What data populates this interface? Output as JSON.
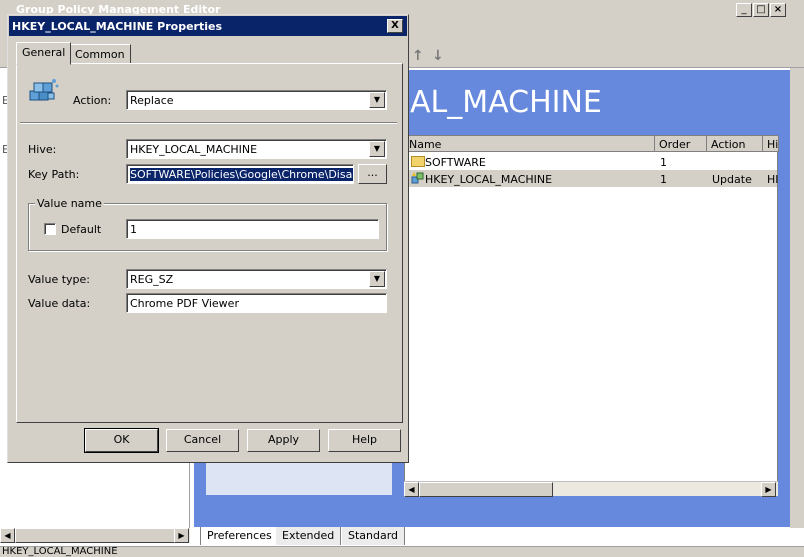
{
  "background": {
    "window_title": "Group Policy Management Editor",
    "heading": "AL_MACHINE",
    "list_columns": [
      "Name",
      "Order",
      "Action",
      "Hi"
    ],
    "list_rows": [
      {
        "name": "SOFTWARE",
        "order": "1",
        "action": "",
        "hive": ""
      },
      {
        "name": "HKEY_LOCAL_MACHINE",
        "order": "1",
        "action": "Update",
        "hive": "HI"
      }
    ],
    "bottom_tabs": [
      "Preferences",
      "Extended",
      "Standard"
    ],
    "status_text": "HKEY_LOCAL_MACHINE",
    "left_pane_letters": [
      "E",
      "E"
    ]
  },
  "dialog": {
    "title": "HKEY_LOCAL_MACHINE Properties",
    "close_label": "X",
    "tabs": [
      "General",
      "Common"
    ],
    "action_label": "Action:",
    "action_value": "Replace",
    "hive_label": "Hive:",
    "hive_value": "HKEY_LOCAL_MACHINE",
    "keypath_label": "Key Path:",
    "keypath_value": "SOFTWARE\\Policies\\Google\\Chrome\\DisabledP",
    "browse_label": "...",
    "value_name_group": "Value name",
    "default_label": "Default",
    "value_name_value": "1",
    "value_type_label": "Value type:",
    "value_type_value": "REG_SZ",
    "value_data_label": "Value data:",
    "value_data_value": "Chrome PDF Viewer",
    "buttons": {
      "ok": "OK",
      "cancel": "Cancel",
      "apply": "Apply",
      "help": "Help"
    }
  },
  "colors": {
    "title_bar": "#0a246a",
    "canvas_blue": "#6688dd",
    "face": "#d4d0c8"
  },
  "icons": [
    "registry-cubes-icon",
    "folder-icon",
    "registry-item-icon",
    "dropdown-arrow-icon"
  ]
}
